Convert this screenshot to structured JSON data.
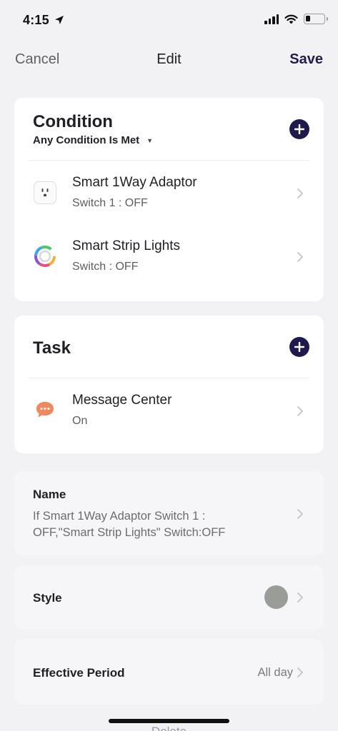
{
  "status_bar": {
    "time": "4:15"
  },
  "nav": {
    "cancel": "Cancel",
    "title": "Edit",
    "save": "Save"
  },
  "condition": {
    "title": "Condition",
    "match_mode": "Any Condition Is Met",
    "items": [
      {
        "title": "Smart 1Way Adaptor",
        "subtitle": "Switch 1 : OFF",
        "icon": "smart-plug-icon"
      },
      {
        "title": "Smart Strip Lights",
        "subtitle": "Switch : OFF",
        "icon": "strip-lights-icon"
      }
    ]
  },
  "task": {
    "title": "Task",
    "items": [
      {
        "title": "Message Center",
        "subtitle": "On",
        "icon": "message-bubble-icon"
      }
    ]
  },
  "name": {
    "label": "Name",
    "value": "If Smart 1Way Adaptor Switch 1 : OFF,\"Smart Strip Lights\" Switch:OFF"
  },
  "style": {
    "label": "Style",
    "color": "#9a9c98"
  },
  "effective_period": {
    "label": "Effective Period",
    "value": "All day"
  },
  "colors": {
    "accent": "#1f1a4e",
    "message_icon": "#f0875d"
  },
  "footer": {
    "partial_text": "Delete"
  }
}
